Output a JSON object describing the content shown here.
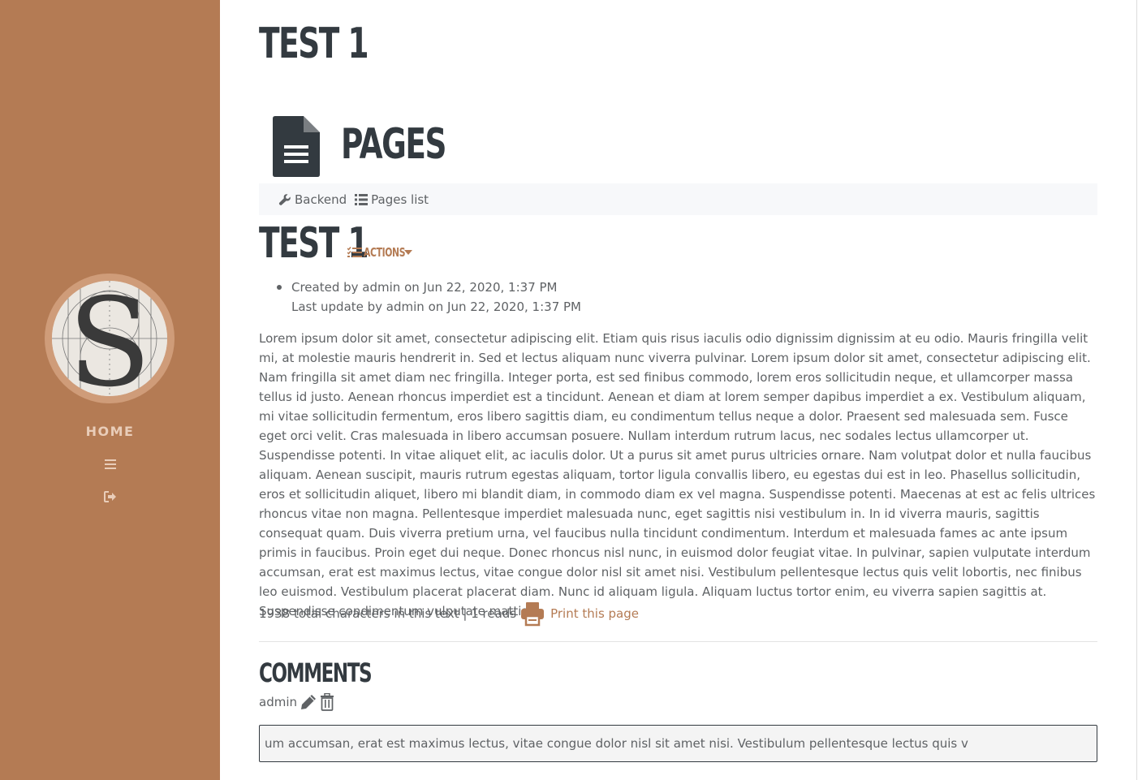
{
  "sidebar": {
    "logo_letter": "S",
    "home_label": "HOME",
    "menu_icon": "bars-icon",
    "logout_icon": "sign-out-icon",
    "bg_color": "#b47b54"
  },
  "page": {
    "title": "TEST 1",
    "module_title": "PAGES",
    "module_icon": "file-text-icon"
  },
  "subnav": {
    "backend_label": "Backend",
    "pages_list_label": "Pages list"
  },
  "article": {
    "title": "TEST 1",
    "actions_label": "ACTIONS",
    "created": "Created by admin on Jun 22, 2020, 1:37 PM",
    "updated": "Last update by admin on Jun 22, 2020, 1:37 PM",
    "body": "Lorem ipsum dolor sit amet, consectetur adipiscing elit. Etiam quis risus iaculis odio dignissim dignissim at eu odio. Mauris fringilla velit mi, at molestie mauris hendrerit in. Sed et lectus aliquam nunc viverra pulvinar. Lorem ipsum dolor sit amet, consectetur adipiscing elit. Nam fringilla sit amet diam nec fringilla. Integer porta, est sed finibus commodo, lorem eros sollicitudin neque, et ullamcorper massa tellus id justo. Aenean rhoncus imperdiet est a tincidunt. Aenean et diam at lorem semper dapibus imperdiet a ex. Vestibulum aliquam, mi vitae sollicitudin fermentum, eros libero sagittis diam, eu condimentum tellus neque a dolor. Praesent sed malesuada sem. Fusce eget orci velit. Cras malesuada in libero accumsan posuere. Nullam interdum rutrum lacus, nec sodales lectus ullamcorper ut. Suspendisse potenti. In vitae aliquet elit, ac iaculis dolor. Ut a purus sit amet purus ultricies ornare. Nam volutpat dolor et nulla faucibus aliquam. Aenean suscipit, mauris rutrum egestas aliquam, tortor ligula convallis libero, eu egestas dui est in leo. Phasellus sollicitudin, eros et sollicitudin aliquet, libero mi blandit diam, in commodo diam ex vel magna. Suspendisse potenti. Maecenas at est ac felis ultrices rhoncus vitae non magna. Pellentesque imperdiet malesuada nunc, eget sagittis nisi vestibulum in. In id viverra mauris, sagittis consequat quam. Duis viverra pretium urna, vel faucibus nulla tincidunt condimentum. Interdum et malesuada fames ac ante ipsum primis in faucibus. Proin eget dui neque. Donec rhoncus nisl nunc, in euismod dolor feugiat vitae. In pulvinar, sapien vulputate interdum accumsan, erat est maximus lectus, vitae congue dolor nisl sit amet nisi. Vestibulum pellentesque lectus quis velit lobortis, nec finibus leo euismod. Vestibulum placerat placerat diam. Nunc id aliquam ligula. Aliquam luctus tortor enim, eu viverra sapien sagittis at. Suspendisse condimentum vulputate mattis.",
    "stats": "1938 total characters in this text | 1 reads",
    "print_label": "Print this page"
  },
  "comments": {
    "title": "COMMENTS",
    "author": "admin",
    "text": "um accumsan, erat est maximus lectus, vitae congue dolor nisl sit amet nisi. Vestibulum pellentesque lectus quis v"
  },
  "colors": {
    "accent": "#b47b54",
    "heading": "#333a40",
    "text": "#5f6265"
  }
}
